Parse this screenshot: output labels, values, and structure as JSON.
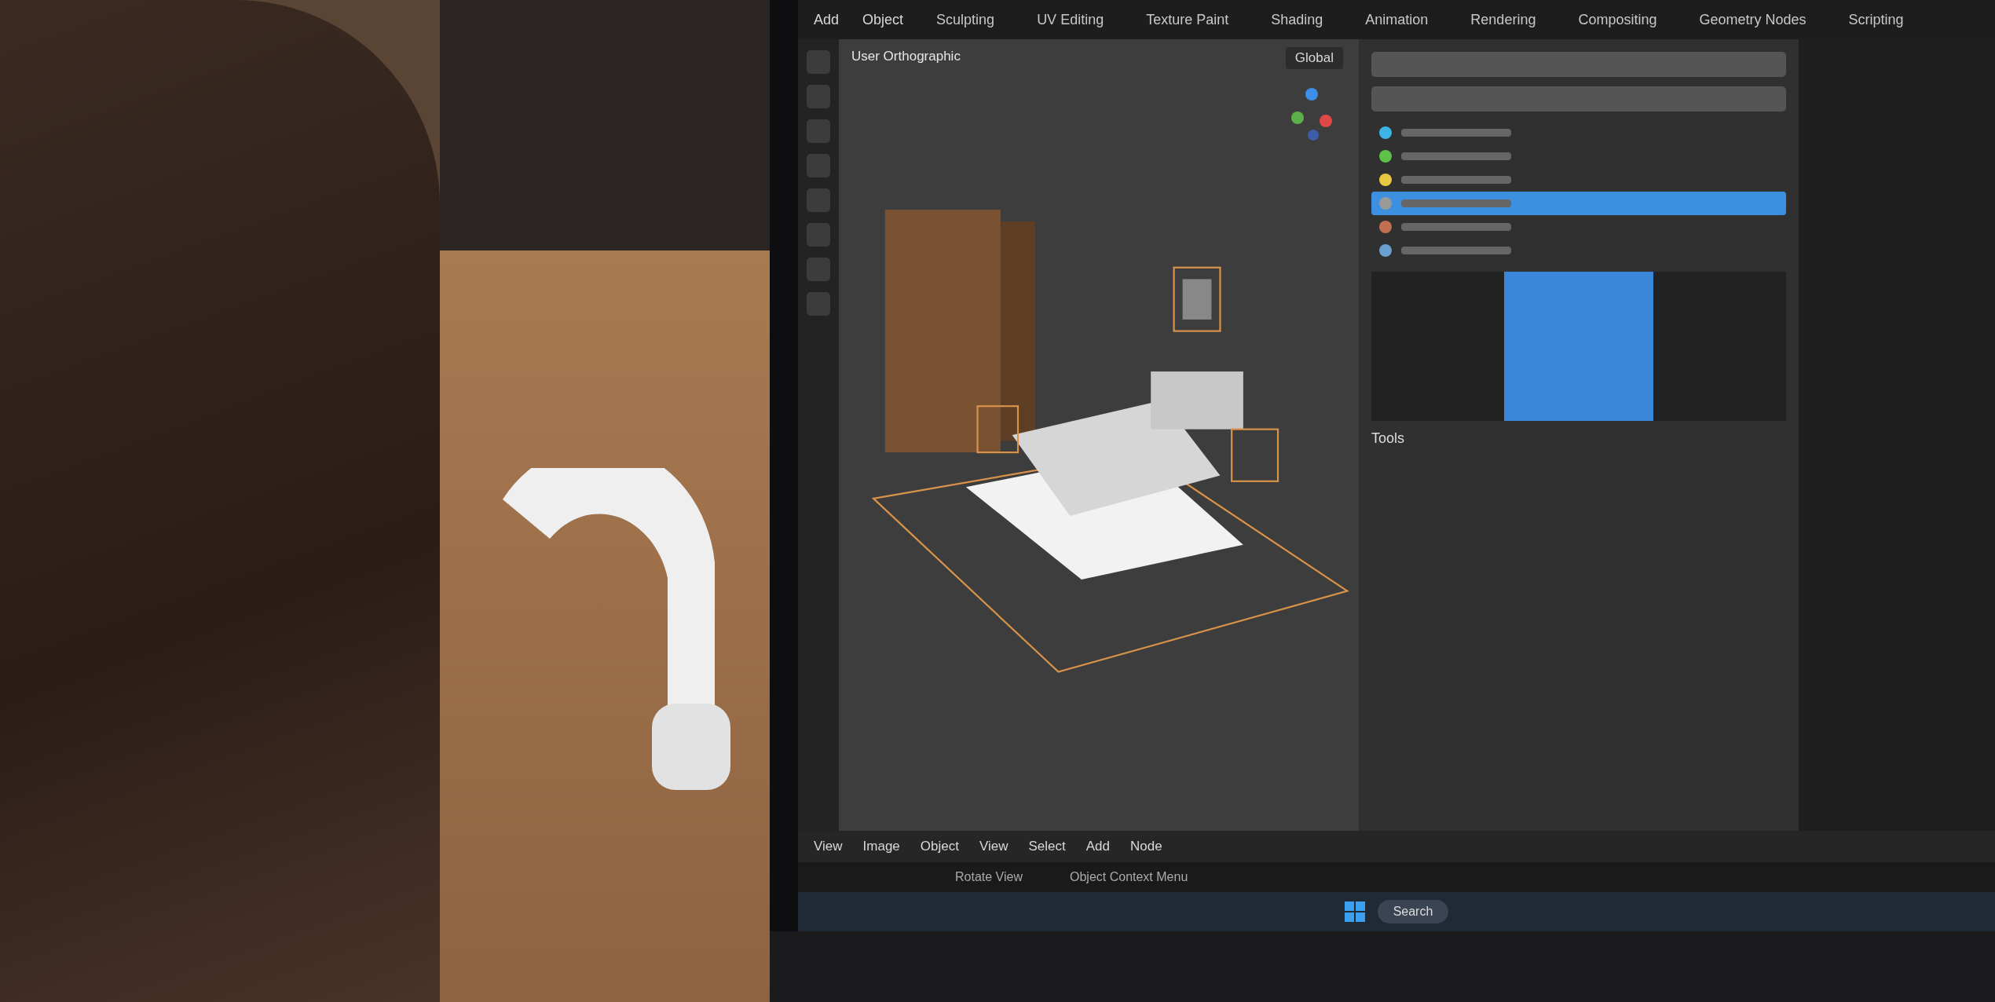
{
  "screen": {
    "workspaces": [
      {
        "label": "Sculpting",
        "selected": false
      },
      {
        "label": "UV Editing",
        "selected": false
      },
      {
        "label": "Texture Paint",
        "selected": false
      },
      {
        "label": "Shading",
        "selected": false
      },
      {
        "label": "Animation",
        "selected": false
      },
      {
        "label": "Rendering",
        "selected": false
      },
      {
        "label": "Compositing",
        "selected": false
      },
      {
        "label": "Geometry Nodes",
        "selected": false
      },
      {
        "label": "Scripting",
        "selected": false
      }
    ],
    "header_menu": [
      "Add",
      "Object"
    ],
    "viewport_info": "User Orthographic",
    "transform_orientation": "Global",
    "outliner_rows": [
      {
        "color": "#3cb4e6",
        "selected": false
      },
      {
        "color": "#5cc24a",
        "selected": false
      },
      {
        "color": "#e8c840",
        "selected": false
      },
      {
        "color": "#9a9a9a",
        "selected": true
      },
      {
        "color": "#c07050",
        "selected": false
      },
      {
        "color": "#6aa0d0",
        "selected": false
      }
    ],
    "tools_label": "Tools",
    "editor_menu": [
      "View",
      "Image",
      "Object",
      "View",
      "Select",
      "Add",
      "Node"
    ],
    "status_items": [
      "Rotate View",
      "Object Context Menu"
    ],
    "taskbar_search": "Search"
  }
}
